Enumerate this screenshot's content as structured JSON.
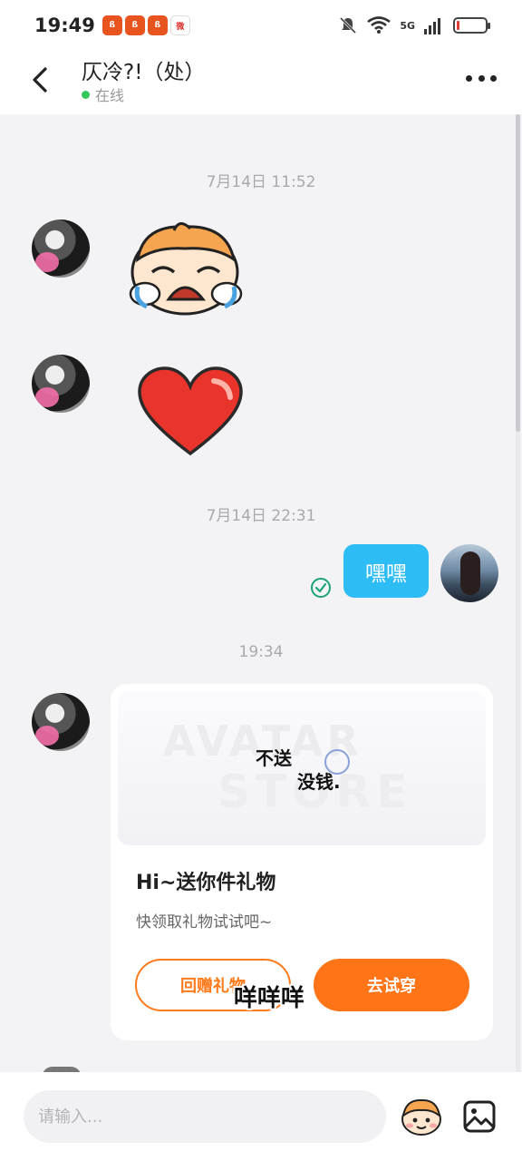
{
  "status_bar": {
    "time": "19:49",
    "app_icons": [
      "app-1-icon",
      "app-2-icon",
      "app-3-icon",
      "weibo-icon"
    ],
    "app_labels": [
      "ß",
      "ß",
      "ß",
      "微"
    ],
    "network": "5G",
    "battery_level": 0.1
  },
  "header": {
    "title": "仄冷?!（处）",
    "status": "在线"
  },
  "messages": {
    "timestamp_1": "7月14日 11:52",
    "timestamp_2": "7月14日 22:31",
    "timestamp_3": "19:34",
    "outgoing_text": "嘿嘿"
  },
  "gift_card": {
    "title": "Hi~送你件礼物",
    "subtitle": "快领取礼物试试吧~",
    "return_button": "回赠礼物",
    "try_button": "去试穿"
  },
  "overlay": {
    "text_1": "不送",
    "text_2": "没钱.",
    "text_3": "咩咩咩"
  },
  "input": {
    "placeholder": "请输入..."
  }
}
